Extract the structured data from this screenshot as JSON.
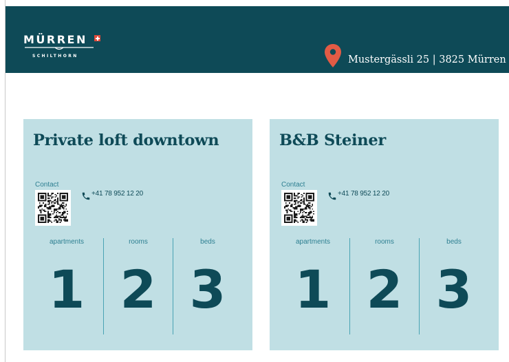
{
  "header": {
    "logo_main": "MÜRREN",
    "logo_sub": "SCHILTHORN",
    "address": "Mustergässli 25 | 3825 Mürren",
    "background_color": "#0e4a57",
    "pin_color": "#e25b45",
    "pin_icon": "location-pin-icon"
  },
  "cards": [
    {
      "title": "Private loft downtown",
      "contact_label": "Contact",
      "phone": "+41 78 952 12 20",
      "stats": [
        {
          "label": "apartments",
          "value": "1"
        },
        {
          "label": "rooms",
          "value": "2"
        },
        {
          "label": "beds",
          "value": "3"
        }
      ]
    },
    {
      "title": "B&B Steiner",
      "contact_label": "Contact",
      "phone": "+41 78 952 12 20",
      "stats": [
        {
          "label": "apartments",
          "value": "1"
        },
        {
          "label": "rooms",
          "value": "2"
        },
        {
          "label": "beds",
          "value": "3"
        }
      ]
    }
  ],
  "colors": {
    "card_background": "#c0dfe4",
    "accent_dark": "#0e4a57",
    "accent_light": "#2d7f91"
  }
}
